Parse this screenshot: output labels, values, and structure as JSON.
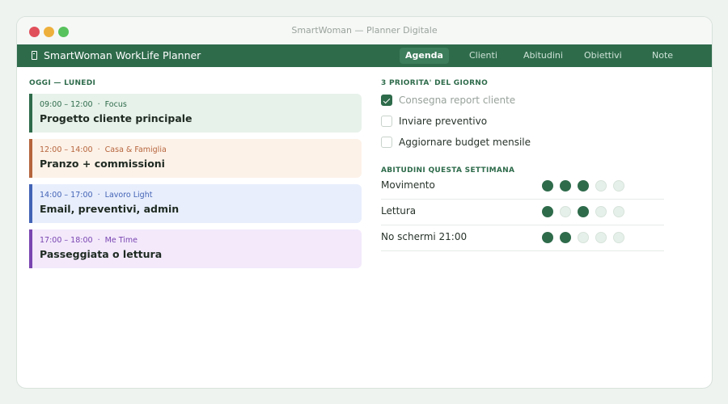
{
  "window": {
    "title": "SmartWoman — Planner Digitale"
  },
  "app": {
    "brand": "SmartWoman WorkLife Planner",
    "brand_icon": "phone-icon"
  },
  "tabs": [
    {
      "label": "Agenda",
      "active": true
    },
    {
      "label": "Clienti",
      "active": false
    },
    {
      "label": "Abitudini",
      "active": false
    },
    {
      "label": "Obiettivi",
      "active": false
    },
    {
      "label": "Note",
      "active": false
    }
  ],
  "today": {
    "heading": "OGGI — LUNEDI",
    "events": [
      {
        "time": "09:00 – 12:00",
        "sep": "·",
        "category": "Focus",
        "title": "Progetto cliente principale",
        "accent": "#2e6b4b",
        "bg": "#e7f2ea",
        "meta_color": "#2e6b4b"
      },
      {
        "time": "12:00 – 14:00",
        "sep": "·",
        "category": "Casa & Famiglia",
        "title": "Pranzo + commissioni",
        "accent": "#b5653d",
        "bg": "#fdf2e8",
        "meta_color": "#b5653d"
      },
      {
        "time": "14:00 – 17:00",
        "sep": "·",
        "category": "Lavoro Light",
        "title": "Email, preventivi, admin",
        "accent": "#4263b5",
        "bg": "#e8eefc",
        "meta_color": "#4263b5"
      },
      {
        "time": "17:00 – 18:00",
        "sep": "·",
        "category": "Me Time",
        "title": "Passeggiata o lettura",
        "accent": "#7a45b0",
        "bg": "#f3e9fb",
        "meta_color": "#7a45b0"
      }
    ]
  },
  "priorities": {
    "heading": "3 PRIORITA' DEL GIORNO",
    "items": [
      {
        "label": "Consegna report cliente",
        "done": true
      },
      {
        "label": "Inviare preventivo",
        "done": false
      },
      {
        "label": "Aggiornare budget mensile",
        "done": false
      }
    ]
  },
  "habits": {
    "heading": "ABITUDINI QUESTA SETTIMANA",
    "items": [
      {
        "name": "Movimento",
        "days": [
          true,
          true,
          true,
          false,
          false
        ]
      },
      {
        "name": "Lettura",
        "days": [
          true,
          false,
          true,
          false,
          false
        ]
      },
      {
        "name": "No schermi 21:00",
        "days": [
          true,
          true,
          false,
          false,
          false
        ]
      }
    ]
  },
  "colors": {
    "brand": "#2e6b4b",
    "accent_tab": "#3c7d5b",
    "habit_on": "#2e6b4b",
    "habit_off": "#e6f0ea"
  }
}
